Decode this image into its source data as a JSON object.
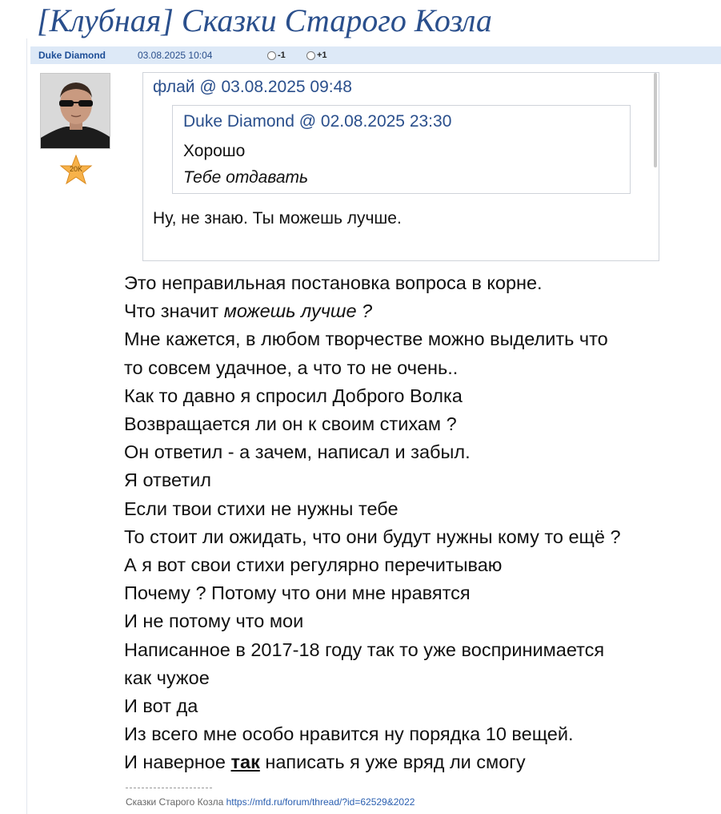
{
  "thread": {
    "title": "[Клубная] Сказки Старого Козла"
  },
  "post": {
    "author": "Duke Diamond",
    "date": "03.08.2025 10:04",
    "vote_minus": "-1",
    "vote_plus": "+1",
    "badge": "20K",
    "quote": {
      "header": "флай @ 03.08.2025 09:48",
      "nested": {
        "header": "Duke Diamond @ 02.08.2025 23:30",
        "line1": "Хорошо",
        "line2": "Тебе отдавать"
      },
      "reply": "Ну, не знаю. Ты можешь лучше."
    },
    "body": {
      "l1": "Это неправильная постановка вопроса в корне.",
      "l2_prefix": "Что значит ",
      "l2_em": "можешь лучше ?",
      "l3": "Мне кажется, в любом творчестве можно выделить что",
      "l4": "то совсем удачное, а что то не очень..",
      "l5": "Как то давно я спросил Доброго Волка",
      "l6": "Возвращается ли он к своим стихам ?",
      "l7": "Он ответил - а зачем, написал и забыл.",
      "l8": "Я ответил",
      "l9": "Если твои стихи не нужны тебе",
      "l10": "То стоит ли ожидать, что они будут нужны кому то ещё ?",
      "l11": "А я вот свои стихи регулярно перечитываю",
      "l12": "Почему ? Потому что они мне нравятся",
      "l13": "И не потому что мои",
      "l14": "Написанное в 2017-18 году так то уже воспринимается",
      "l15": "как чужое",
      "l16": "И вот да",
      "l17": "Из всего мне особо нравится ну порядка 10 вещей.",
      "l18_prefix": "И наверное ",
      "l18_strong": "так",
      "l18_suffix": " написать я уже вряд ли смогу"
    },
    "signature": {
      "divider": "--------------------",
      "text": "Сказки Старого Козла ",
      "link": "https://mfd.ru/forum/thread/?id=62529&2022"
    }
  }
}
